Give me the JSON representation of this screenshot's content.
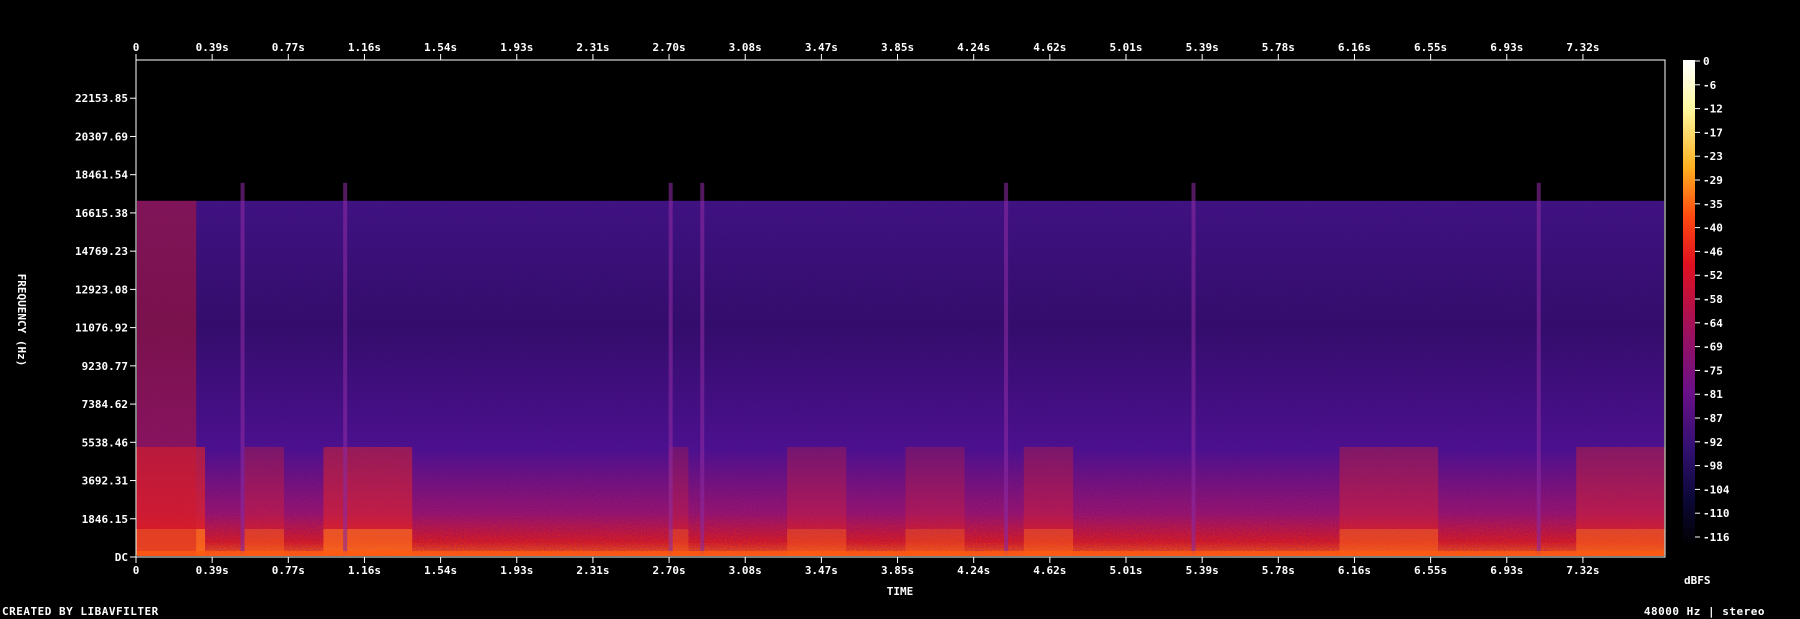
{
  "chart_data": {
    "type": "heatmap",
    "xlabel": "TIME",
    "ylabel": "FREQUENCY (Hz)",
    "x_ticks": [
      "0",
      "0.39s",
      "0.77s",
      "1.16s",
      "1.54s",
      "1.93s",
      "2.31s",
      "2.70s",
      "3.08s",
      "3.47s",
      "3.85s",
      "4.24s",
      "4.62s",
      "5.01s",
      "5.39s",
      "5.78s",
      "6.16s",
      "6.55s",
      "6.93s",
      "7.32s"
    ],
    "y_ticks": [
      "DC",
      "1846.15",
      "3692.31",
      "5538.46",
      "7384.62",
      "9230.77",
      "11076.92",
      "12923.08",
      "14769.23",
      "16615.38",
      "18461.54",
      "20307.69",
      "22153.85"
    ],
    "colorbar_ticks": [
      "0",
      "-6",
      "-12",
      "-17",
      "-23",
      "-29",
      "-35",
      "-40",
      "-46",
      "-52",
      "-58",
      "-64",
      "-69",
      "-75",
      "-81",
      "-87",
      "-92",
      "-98",
      "-104",
      "-110",
      "-116"
    ],
    "colorbar_unit": "dBFS",
    "xlim": [
      0,
      7.75
    ],
    "ylim": [
      0,
      24000
    ],
    "cutoff_hz": 17200
  },
  "footer": {
    "left": "CREATED BY LIBAVFILTER",
    "right": "48000 Hz | stereo"
  }
}
